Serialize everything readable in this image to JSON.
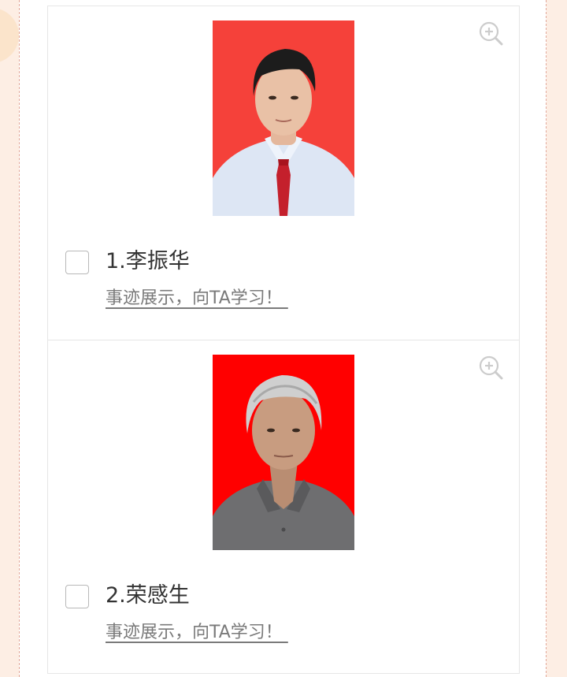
{
  "candidates": [
    {
      "name": "1.李振华",
      "story_link": "事迹展示，向TA学习！ ",
      "photo_background": "#f5413a",
      "shirt_color": "#dde6f4",
      "tie_color": "#c4202c",
      "hair_color": "#1c1c1c"
    },
    {
      "name": "2.荣感生",
      "story_link": "事迹展示，向TA学习！ ",
      "photo_background": "#ff0000",
      "shirt_color": "#6e6e70",
      "hair_color": "#cfcfcf"
    }
  ],
  "icons": {
    "zoom": "zoom-in-icon"
  },
  "colors": {
    "page_background": "#fdf0e8",
    "frame_dash": "#e2a89a",
    "link_text": "#7a7a7a",
    "name_text": "#333333"
  }
}
